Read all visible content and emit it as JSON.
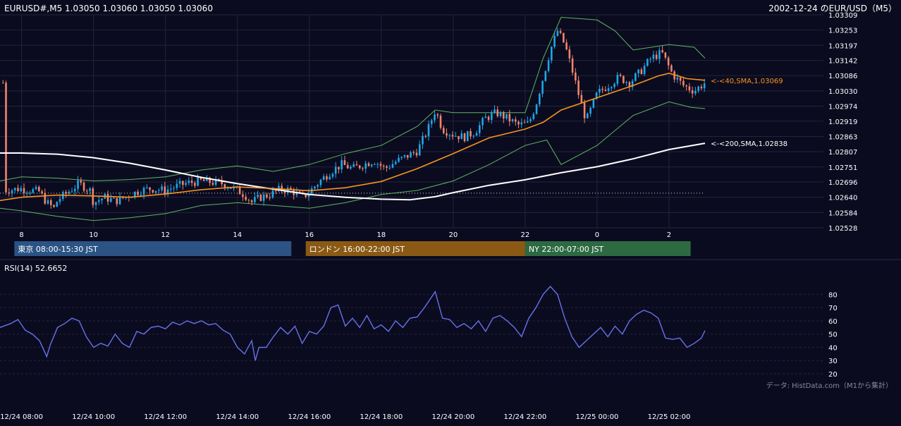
{
  "colors": {
    "background": "#0b0b20",
    "grid": "#23233a",
    "up_candle": "#1ea7e8",
    "down_candle": "#f0846a",
    "sma40": "#f7941d",
    "sma200": "#ffffff",
    "bollinger": "#5cb85c",
    "rsi": "#6672e8",
    "text": "#ffffff",
    "muted_text": "#8a8a99",
    "tokyo": "#2b5384",
    "london": "#8a5a14",
    "ny": "#2d6a42"
  },
  "header": {
    "ohlc": "EURUSD#,M5 1.03050 1.03060 1.03050 1.03060",
    "title": "2002-12-24 のEUR/USD（M5）"
  },
  "sessions": [
    {
      "label": "東京 08:00-15:30 JST",
      "start_hour": 7.8,
      "end_hour": 15.5,
      "color_key": "tokyo"
    },
    {
      "label": "ロンドン 16:00-22:00 JST",
      "start_hour": 15.9,
      "end_hour": 22.0,
      "color_key": "london"
    },
    {
      "label": "NY 22:00-07:00 JST",
      "start_hour": 22.0,
      "end_hour": 26.6,
      "color_key": "ny"
    }
  ],
  "credit": "データ: HistData.com（M1から集計）",
  "chart_data": [
    {
      "type": "candlestick",
      "symbol": "EURUSD#",
      "timeframe": "M5",
      "x_unit": "hours from 2002-12-24 00:00 JST",
      "xlim": [
        7.4,
        27.0
      ],
      "ylim": [
        1.02528,
        1.03309
      ],
      "y_ticks": [
        "1.03309",
        "1.03253",
        "1.03197",
        "1.03142",
        "1.03086",
        "1.03030",
        "1.02974",
        "1.02919",
        "1.02863",
        "1.02807",
        "1.02751",
        "1.02696",
        "1.02640",
        "1.02584",
        "1.02528"
      ],
      "x_ticks": [
        {
          "label": "8",
          "hour": 8
        },
        {
          "label": "10",
          "hour": 10
        },
        {
          "label": "12",
          "hour": 12
        },
        {
          "label": "14",
          "hour": 14
        },
        {
          "label": "16",
          "hour": 16
        },
        {
          "label": "18",
          "hour": 18
        },
        {
          "label": "20",
          "hour": 20
        },
        {
          "label": "22",
          "hour": 22
        },
        {
          "label": "0",
          "hour": 24
        },
        {
          "label": "2",
          "hour": 26
        }
      ],
      "reference_level": 1.02655,
      "candle_closes": [
        [
          7.5,
          1.02665
        ],
        [
          8.0,
          1.02672
        ],
        [
          8.5,
          1.0266
        ],
        [
          8.7,
          1.0262
        ],
        [
          8.9,
          1.026
        ],
        [
          9.0,
          1.0263
        ],
        [
          9.3,
          1.0266
        ],
        [
          9.6,
          1.0269
        ],
        [
          9.9,
          1.02665
        ],
        [
          10.0,
          1.0262
        ],
        [
          10.3,
          1.0264
        ],
        [
          10.6,
          1.02625
        ],
        [
          11.0,
          1.02648
        ],
        [
          11.3,
          1.02665
        ],
        [
          11.6,
          1.02672
        ],
        [
          12.0,
          1.02665
        ],
        [
          12.3,
          1.0268
        ],
        [
          12.6,
          1.02692
        ],
        [
          13.0,
          1.027
        ],
        [
          13.3,
          1.02695
        ],
        [
          13.6,
          1.0269
        ],
        [
          13.9,
          1.02672
        ],
        [
          14.2,
          1.0265
        ],
        [
          14.4,
          1.02622
        ],
        [
          14.6,
          1.02638
        ],
        [
          14.9,
          1.0265
        ],
        [
          15.2,
          1.0267
        ],
        [
          15.5,
          1.02665
        ],
        [
          15.8,
          1.0264
        ],
        [
          16.0,
          1.0266
        ],
        [
          16.3,
          1.027
        ],
        [
          16.6,
          1.02735
        ],
        [
          16.9,
          1.0276
        ],
        [
          17.2,
          1.02745
        ],
        [
          17.5,
          1.0276
        ],
        [
          17.8,
          1.02775
        ],
        [
          18.1,
          1.02745
        ],
        [
          18.4,
          1.0277
        ],
        [
          18.7,
          1.0279
        ],
        [
          19.0,
          1.0281
        ],
        [
          19.3,
          1.0289
        ],
        [
          19.5,
          1.0296
        ],
        [
          19.7,
          1.0289
        ],
        [
          20.0,
          1.0287
        ],
        [
          20.3,
          1.0286
        ],
        [
          20.6,
          1.0288
        ],
        [
          20.9,
          1.0293
        ],
        [
          21.2,
          1.0295
        ],
        [
          21.5,
          1.0293
        ],
        [
          21.8,
          1.02905
        ],
        [
          22.1,
          1.0291
        ],
        [
          22.3,
          1.0298
        ],
        [
          22.5,
          1.0308
        ],
        [
          22.7,
          1.0318
        ],
        [
          22.9,
          1.0325
        ],
        [
          23.1,
          1.032
        ],
        [
          23.3,
          1.0311
        ],
        [
          23.5,
          1.0301
        ],
        [
          23.7,
          1.0292
        ],
        [
          24.0,
          1.0302
        ],
        [
          24.3,
          1.0305
        ],
        [
          24.6,
          1.0308
        ],
        [
          24.9,
          1.0306
        ],
        [
          25.2,
          1.031
        ],
        [
          25.5,
          1.0315
        ],
        [
          25.8,
          1.0317
        ],
        [
          26.1,
          1.0309
        ],
        [
          26.4,
          1.0305
        ],
        [
          26.7,
          1.0303
        ],
        [
          27.0,
          1.0306
        ]
      ],
      "series": [
        {
          "name": "40,SMA",
          "label": "<-<40,SMA,1.03069",
          "last": 1.03069
        },
        {
          "name": "200,SMA",
          "label": "<-<200,SMA,1.02838",
          "last": 1.02838
        }
      ],
      "sma200": [
        [
          7.4,
          1.02802
        ],
        [
          8.0,
          1.02802
        ],
        [
          9.0,
          1.02798
        ],
        [
          10.0,
          1.02785
        ],
        [
          11.0,
          1.02765
        ],
        [
          12.0,
          1.0274
        ],
        [
          13.0,
          1.02713
        ],
        [
          14.0,
          1.0269
        ],
        [
          15.0,
          1.0267
        ],
        [
          16.0,
          1.0265
        ],
        [
          17.0,
          1.0264
        ],
        [
          18.0,
          1.02633
        ],
        [
          18.8,
          1.02631
        ],
        [
          19.5,
          1.02642
        ],
        [
          20.0,
          1.02657
        ],
        [
          21.0,
          1.02684
        ],
        [
          22.0,
          1.02704
        ],
        [
          23.0,
          1.0273
        ],
        [
          24.0,
          1.02752
        ],
        [
          25.0,
          1.02781
        ],
        [
          26.0,
          1.02815
        ],
        [
          27.0,
          1.02838
        ]
      ],
      "sma40": [
        [
          7.4,
          1.02628
        ],
        [
          8.0,
          1.0264
        ],
        [
          9.0,
          1.02648
        ],
        [
          10.0,
          1.02645
        ],
        [
          11.0,
          1.0264
        ],
        [
          12.0,
          1.02652
        ],
        [
          13.0,
          1.02668
        ],
        [
          14.0,
          1.02678
        ],
        [
          15.0,
          1.02672
        ],
        [
          16.0,
          1.02664
        ],
        [
          17.0,
          1.02675
        ],
        [
          18.0,
          1.02698
        ],
        [
          19.0,
          1.02745
        ],
        [
          20.0,
          1.028
        ],
        [
          21.0,
          1.02858
        ],
        [
          22.0,
          1.0289
        ],
        [
          22.5,
          1.02915
        ],
        [
          23.0,
          1.0296
        ],
        [
          24.0,
          1.03005
        ],
        [
          25.0,
          1.0305
        ],
        [
          25.7,
          1.03085
        ],
        [
          26.0,
          1.03095
        ],
        [
          26.5,
          1.03075
        ],
        [
          27.0,
          1.03069
        ]
      ],
      "bollinger_upper": [
        [
          7.4,
          1.027
        ],
        [
          8.0,
          1.02715
        ],
        [
          9.0,
          1.0271
        ],
        [
          10.0,
          1.027
        ],
        [
          11.0,
          1.02705
        ],
        [
          12.0,
          1.02715
        ],
        [
          13.0,
          1.0274
        ],
        [
          14.0,
          1.02755
        ],
        [
          15.0,
          1.02735
        ],
        [
          16.0,
          1.0276
        ],
        [
          17.0,
          1.028
        ],
        [
          18.0,
          1.0283
        ],
        [
          19.0,
          1.029
        ],
        [
          19.5,
          1.0296
        ],
        [
          20.0,
          1.0295
        ],
        [
          21.0,
          1.0295
        ],
        [
          22.0,
          1.0295
        ],
        [
          22.5,
          1.0315
        ],
        [
          23.0,
          1.033
        ],
        [
          24.0,
          1.0329
        ],
        [
          24.5,
          1.0325
        ],
        [
          25.0,
          1.0318
        ],
        [
          26.0,
          1.032
        ],
        [
          26.7,
          1.0319
        ],
        [
          27.0,
          1.0315
        ]
      ],
      "bollinger_lower": [
        [
          7.4,
          1.026
        ],
        [
          8.0,
          1.0259
        ],
        [
          9.0,
          1.0257
        ],
        [
          10.0,
          1.02555
        ],
        [
          11.0,
          1.02565
        ],
        [
          12.0,
          1.0258
        ],
        [
          13.0,
          1.0261
        ],
        [
          14.0,
          1.0262
        ],
        [
          15.0,
          1.0261
        ],
        [
          16.0,
          1.026
        ],
        [
          17.0,
          1.0262
        ],
        [
          18.0,
          1.0265
        ],
        [
          19.0,
          1.02665
        ],
        [
          20.0,
          1.027
        ],
        [
          21.0,
          1.0276
        ],
        [
          22.0,
          1.0283
        ],
        [
          22.6,
          1.0285
        ],
        [
          23.0,
          1.0276
        ],
        [
          24.0,
          1.0283
        ],
        [
          25.0,
          1.0294
        ],
        [
          26.0,
          1.0299
        ],
        [
          26.6,
          1.0297
        ],
        [
          27.0,
          1.02965
        ]
      ]
    },
    {
      "type": "line",
      "name": "RSI(14)",
      "label": "RSI(14) 52.6652",
      "last": 52.6652,
      "ylim": [
        20,
        85
      ],
      "y_ticks": [
        "80",
        "70",
        "60",
        "50",
        "40",
        "30",
        "20"
      ],
      "x_ticks": [
        {
          "label": "12/24 08:00",
          "hour": 8
        },
        {
          "label": "12/24 10:00",
          "hour": 10
        },
        {
          "label": "12/24 12:00",
          "hour": 12
        },
        {
          "label": "12/24 14:00",
          "hour": 14
        },
        {
          "label": "12/24 16:00",
          "hour": 16
        },
        {
          "label": "12/24 18:00",
          "hour": 18
        },
        {
          "label": "12/24 20:00",
          "hour": 20
        },
        {
          "label": "12/24 22:00",
          "hour": 22
        },
        {
          "label": "12/25 00:00",
          "hour": 24
        },
        {
          "label": "12/25 02:00",
          "hour": 26
        }
      ],
      "points": [
        [
          7.4,
          55
        ],
        [
          7.7,
          58
        ],
        [
          7.9,
          61
        ],
        [
          8.1,
          53
        ],
        [
          8.3,
          50
        ],
        [
          8.5,
          45
        ],
        [
          8.7,
          33
        ],
        [
          8.8,
          42
        ],
        [
          9.0,
          55
        ],
        [
          9.2,
          58
        ],
        [
          9.4,
          62
        ],
        [
          9.6,
          60
        ],
        [
          9.8,
          48
        ],
        [
          10.0,
          40
        ],
        [
          10.2,
          43
        ],
        [
          10.4,
          41
        ],
        [
          10.6,
          50
        ],
        [
          10.8,
          43
        ],
        [
          11.0,
          40
        ],
        [
          11.2,
          52
        ],
        [
          11.4,
          50
        ],
        [
          11.6,
          55
        ],
        [
          11.8,
          56
        ],
        [
          12.0,
          54
        ],
        [
          12.2,
          59
        ],
        [
          12.4,
          57
        ],
        [
          12.6,
          60
        ],
        [
          12.8,
          58
        ],
        [
          13.0,
          60
        ],
        [
          13.2,
          57
        ],
        [
          13.4,
          58
        ],
        [
          13.6,
          53
        ],
        [
          13.8,
          50
        ],
        [
          14.0,
          40
        ],
        [
          14.2,
          35
        ],
        [
          14.4,
          45
        ],
        [
          14.5,
          30
        ],
        [
          14.6,
          40
        ],
        [
          14.8,
          40
        ],
        [
          15.0,
          48
        ],
        [
          15.2,
          55
        ],
        [
          15.4,
          50
        ],
        [
          15.6,
          56
        ],
        [
          15.8,
          43
        ],
        [
          16.0,
          52
        ],
        [
          16.2,
          50
        ],
        [
          16.4,
          56
        ],
        [
          16.6,
          70
        ],
        [
          16.8,
          72
        ],
        [
          17.0,
          56
        ],
        [
          17.2,
          62
        ],
        [
          17.4,
          55
        ],
        [
          17.6,
          64
        ],
        [
          17.8,
          54
        ],
        [
          18.0,
          57
        ],
        [
          18.2,
          52
        ],
        [
          18.4,
          60
        ],
        [
          18.6,
          55
        ],
        [
          18.8,
          62
        ],
        [
          19.0,
          63
        ],
        [
          19.2,
          70
        ],
        [
          19.4,
          78
        ],
        [
          19.5,
          82
        ],
        [
          19.7,
          62
        ],
        [
          19.9,
          61
        ],
        [
          20.1,
          55
        ],
        [
          20.3,
          58
        ],
        [
          20.5,
          54
        ],
        [
          20.7,
          60
        ],
        [
          20.9,
          52
        ],
        [
          21.1,
          62
        ],
        [
          21.3,
          64
        ],
        [
          21.5,
          60
        ],
        [
          21.7,
          55
        ],
        [
          21.9,
          48
        ],
        [
          22.1,
          62
        ],
        [
          22.3,
          70
        ],
        [
          22.5,
          80
        ],
        [
          22.7,
          86
        ],
        [
          22.9,
          80
        ],
        [
          23.1,
          62
        ],
        [
          23.3,
          48
        ],
        [
          23.5,
          40
        ],
        [
          23.7,
          45
        ],
        [
          23.9,
          50
        ],
        [
          24.1,
          55
        ],
        [
          24.3,
          48
        ],
        [
          24.5,
          56
        ],
        [
          24.7,
          50
        ],
        [
          24.9,
          60
        ],
        [
          25.1,
          65
        ],
        [
          25.3,
          68
        ],
        [
          25.5,
          66
        ],
        [
          25.7,
          62
        ],
        [
          25.9,
          47
        ],
        [
          26.1,
          46
        ],
        [
          26.3,
          47
        ],
        [
          26.5,
          40
        ],
        [
          26.7,
          43
        ],
        [
          26.9,
          47
        ],
        [
          27.0,
          52.6652
        ]
      ]
    }
  ]
}
